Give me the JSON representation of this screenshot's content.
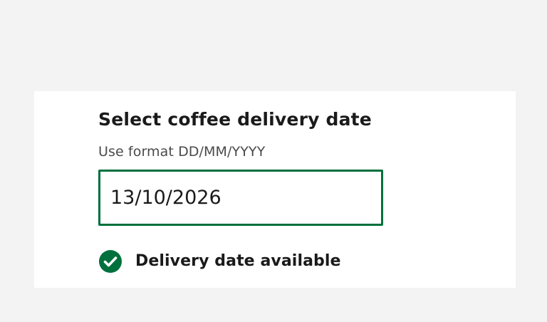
{
  "form": {
    "label": "Select coffee delivery date",
    "hint": "Use format DD/MM/YYYY",
    "date_value": "13/10/2026"
  },
  "status": {
    "text": "Delivery date available",
    "icon": "check-circle-icon",
    "color": "#00703c"
  },
  "colors": {
    "background": "#f3f3f3",
    "card": "#ffffff",
    "accent": "#00703c"
  }
}
